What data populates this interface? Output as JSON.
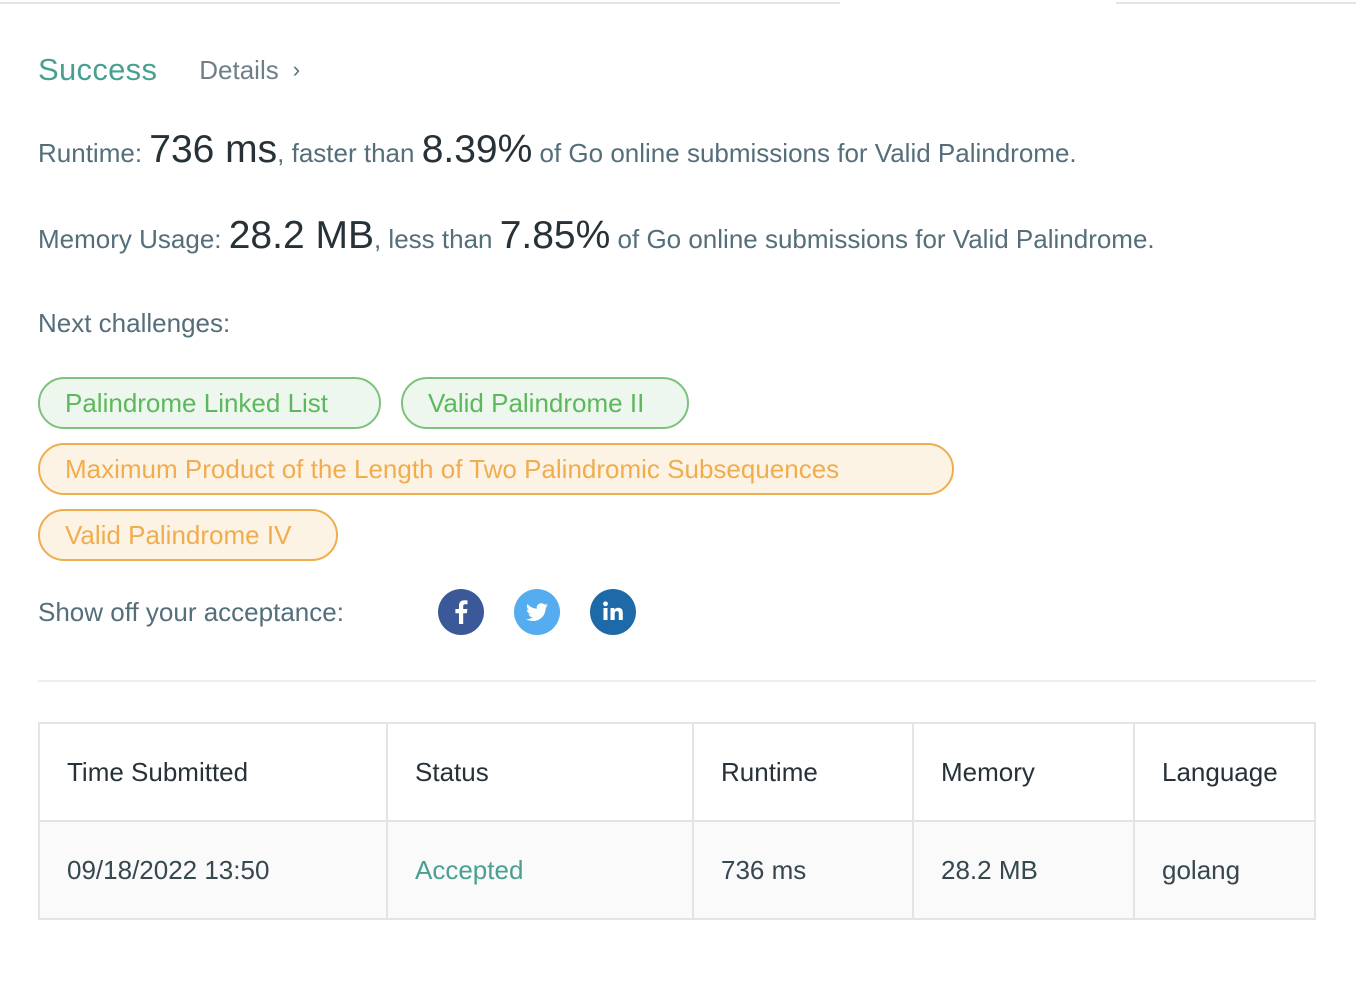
{
  "result": {
    "status_label": "Success",
    "details_label": "Details",
    "details_chevron": "›"
  },
  "runtime": {
    "prefix": "Runtime: ",
    "value": "736 ms",
    "middle": ", faster than ",
    "percent": "8.39%",
    "suffix": " of Go online submissions for Valid Palindrome."
  },
  "memory": {
    "prefix": "Memory Usage: ",
    "value": "28.2 MB",
    "middle": ", less than ",
    "percent": "7.85%",
    "suffix": " of Go online submissions for Valid Palindrome."
  },
  "next_challenges": {
    "label": "Next challenges:",
    "items": [
      {
        "title": "Palindrome Linked List",
        "difficulty": "easy"
      },
      {
        "title": "Valid Palindrome II",
        "difficulty": "easy"
      },
      {
        "title": "Maximum Product of the Length of Two Palindromic Subsequences",
        "difficulty": "medium"
      },
      {
        "title": "Valid Palindrome IV",
        "difficulty": "medium"
      }
    ]
  },
  "share": {
    "label": "Show off your acceptance:",
    "icons": [
      "facebook-icon",
      "twitter-icon",
      "linkedin-icon"
    ]
  },
  "colors": {
    "success": "#4a9f93",
    "easy": "#5cb85c",
    "medium": "#f0ad4e",
    "facebook": "#3b5998",
    "twitter": "#55acee",
    "linkedin": "#1e6aa8"
  },
  "submissions": {
    "headers": [
      "Time Submitted",
      "Status",
      "Runtime",
      "Memory",
      "Language"
    ],
    "rows": [
      [
        "09/18/2022 13:50",
        "Accepted",
        "736 ms",
        "28.2 MB",
        "golang"
      ]
    ]
  }
}
